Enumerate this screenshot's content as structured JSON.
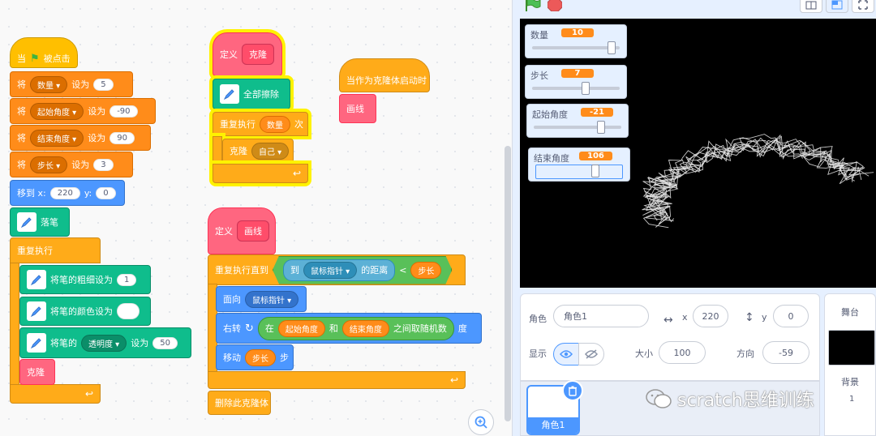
{
  "script": {
    "s1": {
      "hat_when": "当",
      "hat_clicked": "被点击",
      "set_word": "将",
      "set_to": "设为",
      "sets": [
        {
          "var": "数量",
          "value": "5"
        },
        {
          "var": "起始角度",
          "value": "-90"
        },
        {
          "var": "结束角度",
          "value": "90"
        },
        {
          "var": "步长",
          "value": "3"
        }
      ],
      "goto_label": "移到 x:",
      "goto_x": "220",
      "goto_y_label": "y:",
      "goto_y": "0",
      "pen_down": "落笔",
      "forever": "重复执行",
      "pen_size_label": "将笔的粗细设为",
      "pen_size_value": "1",
      "pen_color_label": "将笔的颜色设为",
      "pen_param_prefix": "将笔的",
      "pen_param": "透明度",
      "pen_param_to": "设为",
      "pen_param_value": "50",
      "clone_call": "克隆"
    },
    "s2": {
      "define": "定义",
      "name": "克隆",
      "clear": "全部擦除",
      "repeat": "重复执行",
      "repeat_var": "数量",
      "repeat_times": "次",
      "create_clone": "克隆",
      "clone_target": "自己"
    },
    "s3": {
      "hat": "当作为克隆体启动时",
      "call": "画线"
    },
    "s4": {
      "define": "定义",
      "name": "画线",
      "repeat_until": "重复执行直到",
      "distance_to": "到",
      "mouse": "鼠标指针",
      "distance_suffix": "的距离",
      "lt": "<",
      "step_var": "步长",
      "point_toward": "面向",
      "point_target": "鼠标指针",
      "turn": "右转",
      "random_in": "在",
      "random_a": "起始角度",
      "random_and": "和",
      "random_b": "结束角度",
      "random_suffix": "之间取随机数",
      "degrees": "度",
      "move": "移动",
      "move_var": "步长",
      "steps": "步",
      "delete_clone": "删除此克隆体"
    }
  },
  "monitors": [
    {
      "name": "数量",
      "value": "10",
      "level": 0.95
    },
    {
      "name": "步长",
      "value": "7",
      "level": 0.62
    },
    {
      "name": "起始角度",
      "value": "-21",
      "level": 0.8
    },
    {
      "name": "结束角度",
      "value": "106",
      "level": 0.7
    }
  ],
  "sprite_info": {
    "sprite_label": "角色",
    "sprite_name": "角色1",
    "x_label": "x",
    "x": "220",
    "y_label": "y",
    "y": "0",
    "show_label": "显示",
    "size_label": "大小",
    "size": "100",
    "direction_label": "方向",
    "direction": "-59"
  },
  "sprites": [
    {
      "name": "角色1"
    }
  ],
  "stage_panel": {
    "title": "舞台",
    "backdrop_label": "背景",
    "backdrop_count": "1"
  },
  "watermark": "scratch思维训练",
  "colors": {
    "events": "#ffbf00",
    "variables": "#ff8c1a",
    "motion": "#4c97ff",
    "control": "#ffab19",
    "pen": "#0fbd8c",
    "my_blocks": "#ff6680",
    "sensing": "#5cb1d6",
    "operators": "#59c059"
  }
}
